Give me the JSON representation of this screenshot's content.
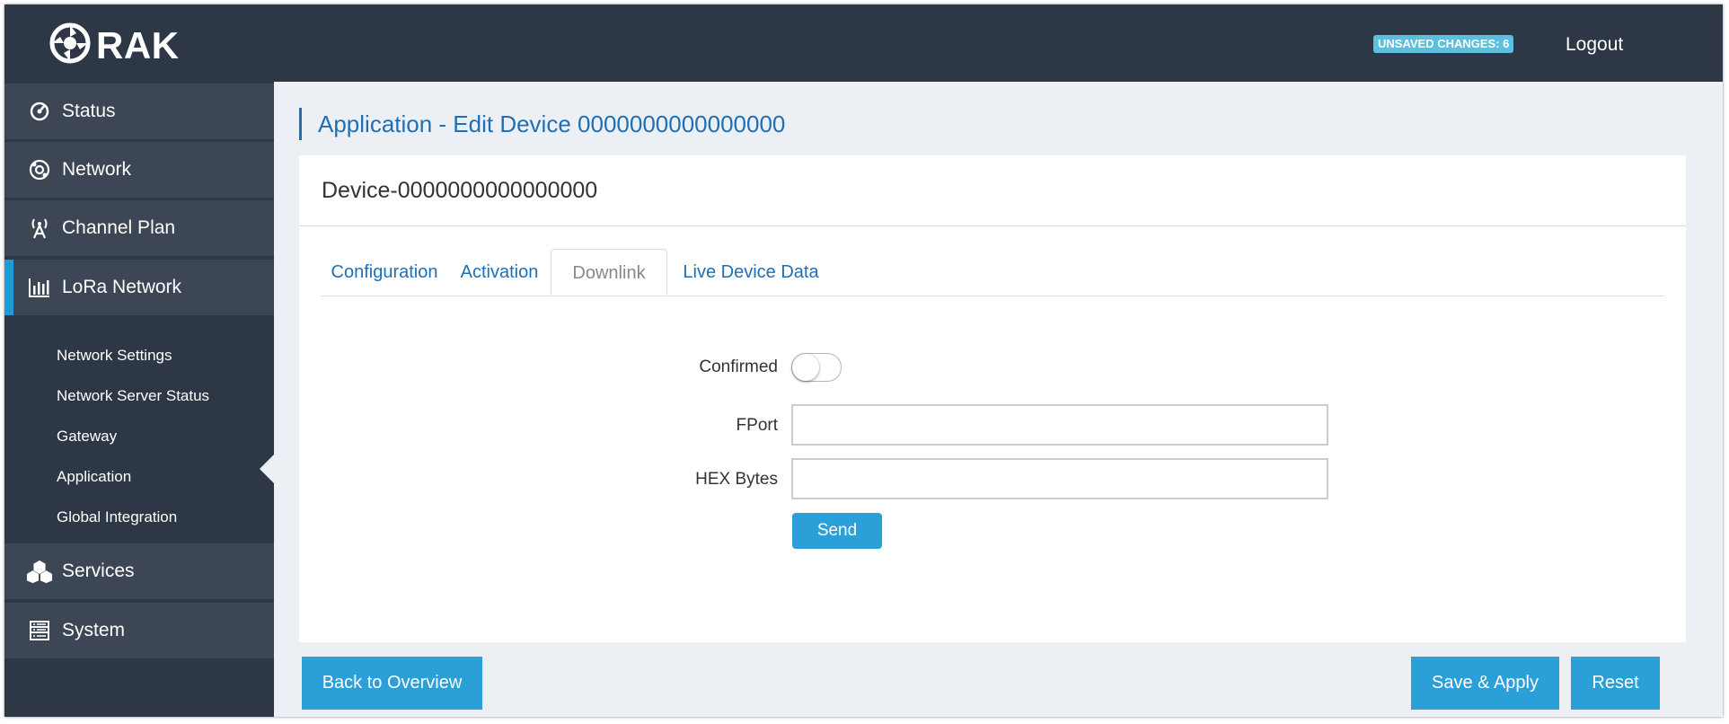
{
  "header": {
    "logo_text": "RAK",
    "unsaved_label": "UNSAVED CHANGES: 6",
    "logout_label": "Logout"
  },
  "sidebar": {
    "items": [
      {
        "label": "Status",
        "icon": "status-icon"
      },
      {
        "label": "Network",
        "icon": "network-icon"
      },
      {
        "label": "Channel Plan",
        "icon": "antenna-icon"
      },
      {
        "label": "LoRa Network",
        "icon": "bar-chart-icon"
      },
      {
        "label": "Services",
        "icon": "cubes-icon"
      },
      {
        "label": "System",
        "icon": "server-icon"
      }
    ],
    "subitems": [
      {
        "label": "Network Settings"
      },
      {
        "label": "Network Server Status"
      },
      {
        "label": "Gateway"
      },
      {
        "label": "Application"
      },
      {
        "label": "Global Integration"
      }
    ],
    "accent_color": "#1f9bd7"
  },
  "main": {
    "page_title": "Application - Edit Device 0000000000000000",
    "device_title": "Device-0000000000000000",
    "tabs": [
      {
        "label": "Configuration"
      },
      {
        "label": "Activation"
      },
      {
        "label": "Downlink"
      },
      {
        "label": "Live Device Data"
      }
    ],
    "active_tab": "Downlink",
    "form": {
      "confirmed_label": "Confirmed",
      "confirmed_value": false,
      "fport_label": "FPort",
      "fport_value": "",
      "hex_label": "HEX Bytes",
      "hex_value": "",
      "send_label": "Send"
    }
  },
  "footer": {
    "back_label": "Back to Overview",
    "save_label": "Save & Apply",
    "reset_label": "Reset"
  },
  "colors": {
    "header_bg": "#2d3746",
    "link_blue": "#1f6fb5",
    "button_blue": "#2a9fd8",
    "badge_blue": "#5bc0de"
  }
}
